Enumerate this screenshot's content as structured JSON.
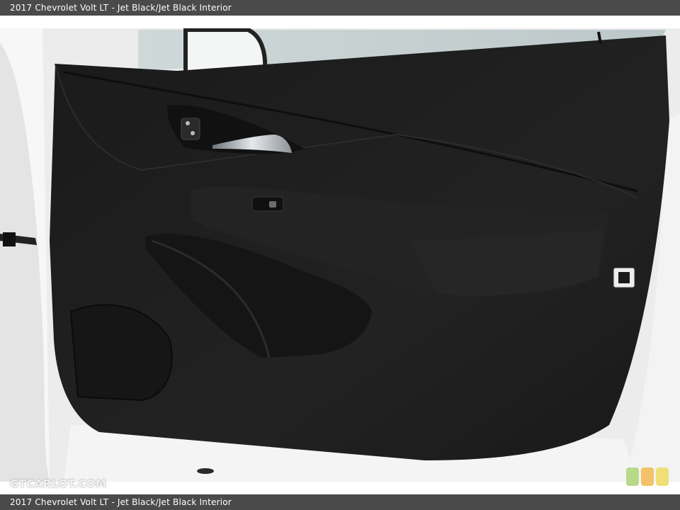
{
  "caption_top": "2017 Chevrolet Volt LT  -  Jet Black/Jet Black Interior",
  "caption_bottom": "2017 Chevrolet Volt LT  -  Jet Black/Jet Black Interior",
  "watermark": "GTCARLOT.COM",
  "colors": {
    "caption_bar": "#4a4a4a",
    "door_panel": "#1c1c1c",
    "vehicle_body": "#f2f2f2",
    "badge_green": "#b9d98a",
    "badge_orange": "#f3c26a",
    "badge_yellow": "#f0df76"
  }
}
